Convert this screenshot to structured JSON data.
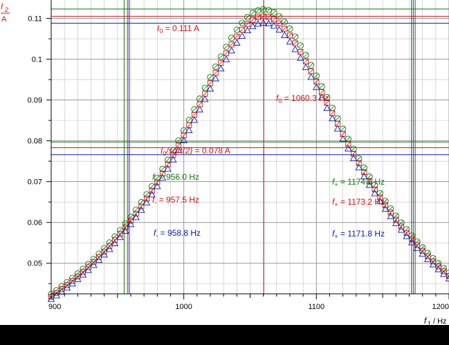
{
  "chart_data": {
    "type": "scatter",
    "title": "",
    "xlabel": "f1 / Hz",
    "xlabel_parts": {
      "symbol": "f",
      "sub": "1",
      "unit": "/ Hz"
    },
    "ylabel_parts": {
      "symbol": "I",
      "sub": "2",
      "unit": "A"
    },
    "xlim": [
      900,
      1200
    ],
    "ylim": [
      0.0425,
      0.1145
    ],
    "x_ticks": [
      900,
      1000,
      1100,
      1200
    ],
    "y_ticks": [
      0.05,
      0.06,
      0.07,
      0.08,
      0.09,
      0.1,
      0.11
    ],
    "y_tick_labels": [
      "0.05",
      "0.06",
      "0.07",
      "0.08",
      "0.09",
      "0.1",
      "0.11"
    ],
    "grid": true,
    "series": [
      {
        "marker": "circle",
        "color": "#0a7a0a",
        "peak": 0.1122,
        "f0": 1060.3,
        "width": 131
      },
      {
        "marker": "square",
        "color": "#d01010",
        "peak": 0.1105,
        "f0": 1060.3,
        "width": 131
      },
      {
        "marker": "triangle",
        "color": "#0a1aa8",
        "peak": 0.1089,
        "f0": 1060.3,
        "width": 131
      }
    ],
    "x_start": 900,
    "x_end": 1200,
    "x_step": 4,
    "reference_lines": {
      "vertical": [
        {
          "x": 955.0,
          "color": "#0a7a0a"
        },
        {
          "x": 957.5,
          "color": "#d01010"
        },
        {
          "x": 958.8,
          "color": "#0a1aa8"
        },
        {
          "x": 1060.3,
          "color": "#d01010"
        },
        {
          "x": 1171.8,
          "color": "#0a1aa8"
        },
        {
          "x": 1173.2,
          "color": "#d01010"
        },
        {
          "x": 1174.5,
          "color": "#0a7a0a"
        }
      ],
      "horizontal": [
        {
          "y": 0.1123,
          "color": "#0a7a0a"
        },
        {
          "y": 0.1105,
          "color": "#d01010"
        },
        {
          "y": 0.1088,
          "color": "#0a1aa8"
        },
        {
          "y": 0.0797,
          "color": "#0a7a0a"
        },
        {
          "y": 0.0783,
          "color": "#d01010"
        },
        {
          "y": 0.0766,
          "color": "#0a1aa8"
        }
      ]
    }
  },
  "annotations": {
    "i0": {
      "sym": "I",
      "sub": "0",
      "text": " =  0.111 A"
    },
    "f0": {
      "sym": "f",
      "sub": "0",
      "text": " =  1060.3 Hz"
    },
    "isqrt": {
      "sym": "I",
      "sub": "0",
      "mid": "/sqrt(2)",
      "text": " =  0.078 A"
    },
    "fm_green": {
      "sym": "f",
      "sub": "-",
      "text": " =  956.0 Hz"
    },
    "fm_red": {
      "sym": "f",
      "sub": "-",
      "text": " =  957.5 Hz"
    },
    "fm_blue": {
      "sym": "f",
      "sub": "-",
      "text": " =  958.8 Hz"
    },
    "fp_green": {
      "sym": "f",
      "sub": "+",
      "text": " =  1174.5 Hz"
    },
    "fp_red": {
      "sym": "f",
      "sub": "+",
      "text": " =  1173.2 Hz"
    },
    "fp_blue": {
      "sym": "f",
      "sub": "+",
      "text": " =  1171.8 Hz"
    }
  },
  "colors": {
    "green": "#0a7a0a",
    "red": "#d01010",
    "blue": "#0a1aa8",
    "grid": "#8a8a8a"
  }
}
